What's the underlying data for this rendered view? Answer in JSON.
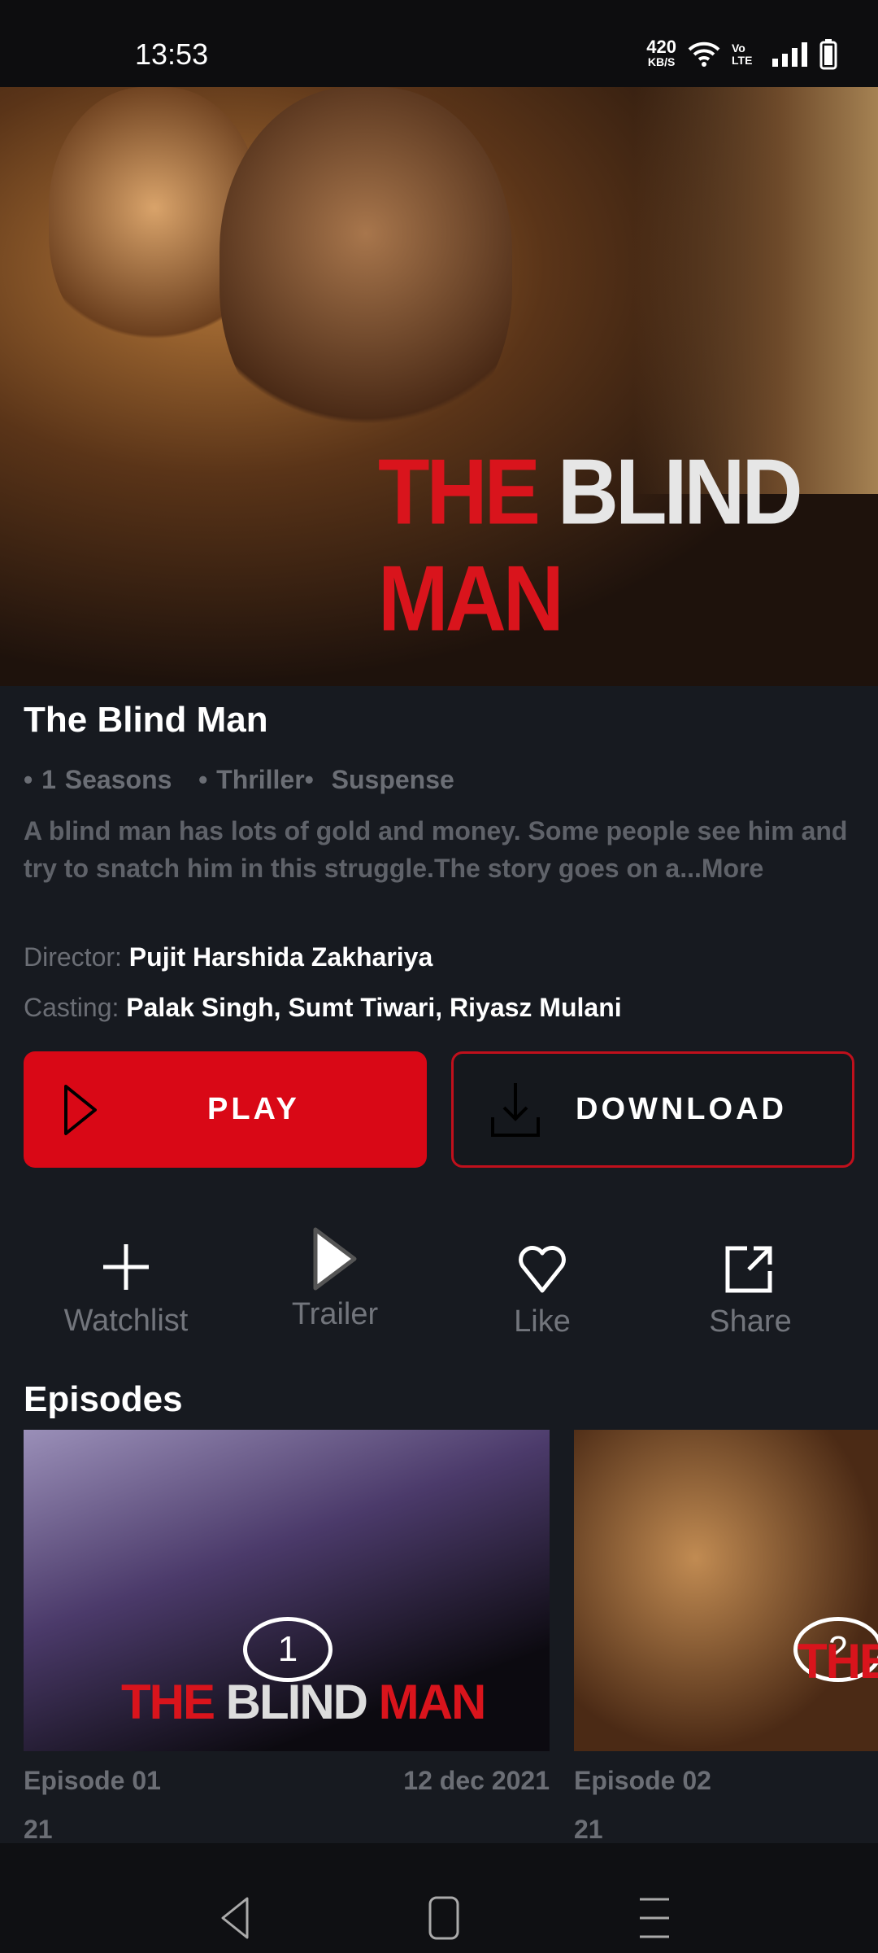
{
  "status_bar": {
    "time": "13:53",
    "net_speed": "420",
    "net_unit": "KB/S",
    "volte": "Vo LTE",
    "icons": [
      "wifi-icon",
      "signal-icon",
      "battery-icon"
    ]
  },
  "hero": {
    "logo_text_red": "THE",
    "logo_text_white": "BLIND",
    "logo_text_red2": "MAN"
  },
  "show": {
    "title": "The Blind Man",
    "meta": "• 1 Seasons   • Thriller•  Suspense",
    "description": "A blind man has lots of gold and money.  Some people see him and try to snatch him in this struggle.The story goes on a...More",
    "director_label": "Director:",
    "director": "Pujit Harshida Zakhariya",
    "casting_label": "Casting:",
    "casting": "Palak Singh, Sumt Tiwari, Riyasz Mulani"
  },
  "buttons": {
    "play": "PLAY",
    "download": "DOWNLOAD"
  },
  "actions": [
    {
      "label": "Watchlist",
      "icon": "plus-icon"
    },
    {
      "label": "Trailer",
      "icon": "play-icon"
    },
    {
      "label": "Like",
      "icon": "heart-icon"
    },
    {
      "label": "Share",
      "icon": "share-icon"
    }
  ],
  "episodes": {
    "heading": "Episodes",
    "items": [
      {
        "number": "1",
        "title": "Episode 01",
        "date": "12 dec 2021",
        "sub": "21"
      },
      {
        "number": "2",
        "title": "Episode 02",
        "date": "",
        "sub": "21"
      }
    ]
  },
  "colors": {
    "accent": "#d90816",
    "background": "#171a20"
  }
}
